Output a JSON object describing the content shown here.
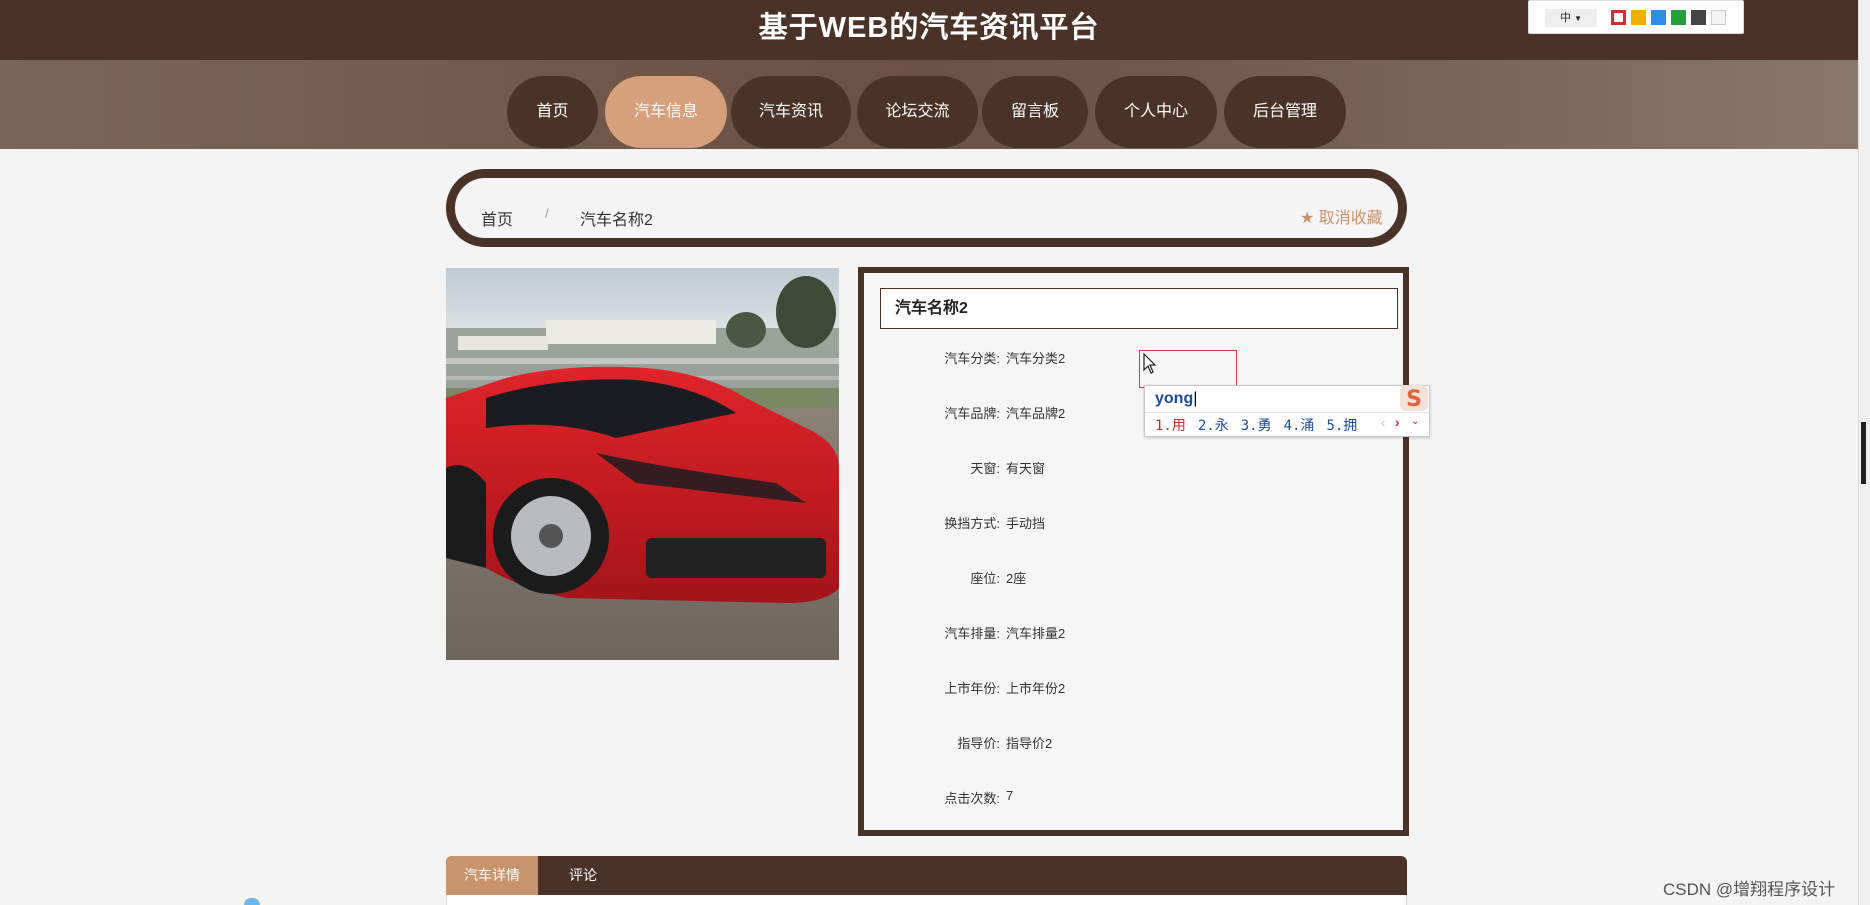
{
  "site": {
    "title": "基于WEB的汽车资讯平台"
  },
  "theme_panel": {
    "language": "中",
    "swatch_colors": [
      "#d82a2a",
      "#f0b000",
      "#2b8ee6",
      "#22a03a",
      "#444444",
      "#f5f5f5"
    ]
  },
  "nav": {
    "items": [
      {
        "label": "首页",
        "active": false
      },
      {
        "label": "汽车信息",
        "active": true
      },
      {
        "label": "汽车资讯",
        "active": false
      },
      {
        "label": "论坛交流",
        "active": false
      },
      {
        "label": "留言板",
        "active": false
      },
      {
        "label": "个人中心",
        "active": false
      },
      {
        "label": "后台管理",
        "active": false
      }
    ]
  },
  "breadcrumb": {
    "home": "首页",
    "separator": "/",
    "current": "汽车名称2",
    "favorite_label": "取消收藏"
  },
  "detail": {
    "title": "汽车名称2",
    "fields": [
      {
        "label": "汽车分类:",
        "value": "汽车分类2"
      },
      {
        "label": "汽车品牌:",
        "value": "汽车品牌2"
      },
      {
        "label": "天窗:",
        "value": "有天窗"
      },
      {
        "label": "换挡方式:",
        "value": "手动挡"
      },
      {
        "label": "座位:",
        "value": "2座"
      },
      {
        "label": "汽车排量:",
        "value": "汽车排量2"
      },
      {
        "label": "上市年份:",
        "value": "上市年份2"
      },
      {
        "label": "指导价:",
        "value": "指导价2"
      },
      {
        "label": "点击次数:",
        "value": "7"
      }
    ]
  },
  "ime": {
    "composition": "yong",
    "candidates": [
      "1.用",
      "2.永",
      "3.勇",
      "4.涌",
      "5.拥"
    ]
  },
  "tabs": [
    {
      "label": "汽车详情",
      "active": true
    },
    {
      "label": "评论",
      "active": false
    }
  ],
  "watermark": "CSDN @增翔程序设计",
  "colors": {
    "primary_brown": "#4b3226",
    "accent_tan": "#d5a07b",
    "favorite_color": "#c8946d"
  }
}
